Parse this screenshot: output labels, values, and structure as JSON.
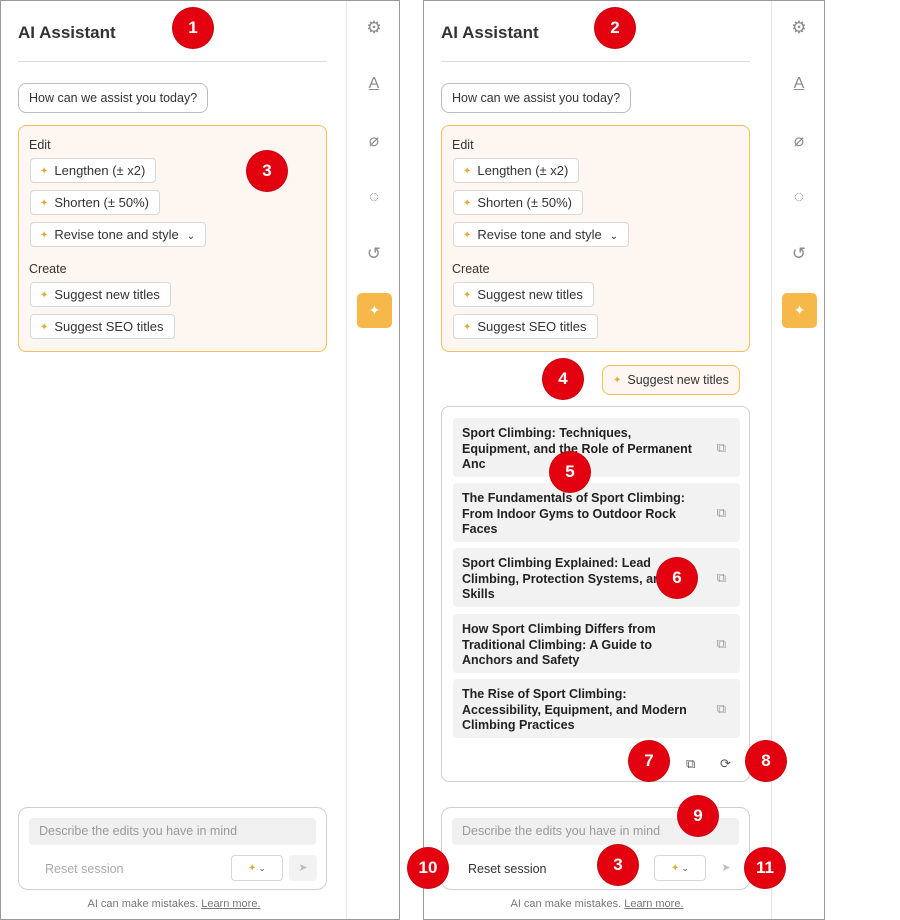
{
  "app_title": "AI Assistant",
  "prompt_chip": "How can we assist you today?",
  "sections": {
    "edit_label": "Edit",
    "create_label": "Create"
  },
  "actions": {
    "lengthen": "Lengthen (± x2)",
    "shorten": "Shorten (± 50%)",
    "revise": "Revise tone and style",
    "suggest_titles": "Suggest new titles",
    "suggest_seo": "Suggest SEO titles"
  },
  "sent_request": "Suggest new titles",
  "results": [
    "Sport Climbing: Techniques, Equipment, and the Role of Permanent Anc",
    "The Fundamentals of Sport Climbing: From Indoor Gyms to Outdoor Rock Faces",
    "Sport Climbing Explained: Lead Climbing, Protection Systems, an Core Skills",
    "How Sport Climbing Differs from Traditional Climbing: A Guide to Anchors and Safety",
    "The Rise of Sport Climbing: Accessibility, Equipment, and Modern Climbing Practices"
  ],
  "input": {
    "placeholder": "Describe the edits you have in mind",
    "reset_label": "Reset session"
  },
  "disclaimer": {
    "text": "AI can make mistakes.",
    "link": "Learn more."
  },
  "rail_icons": [
    "gear-icon",
    "text-format-icon",
    "paperclip-icon",
    "chat-icon",
    "history-icon",
    "sparkle-icon"
  ],
  "badges": [
    "1",
    "2",
    "3",
    "4",
    "5",
    "6",
    "7",
    "8",
    "9",
    "10",
    "3",
    "11"
  ],
  "colors": {
    "accent": "#f7b84a",
    "accent_border": "#f2bf5e",
    "accent_bg": "#fef6f0",
    "badge": "#e3000f"
  }
}
